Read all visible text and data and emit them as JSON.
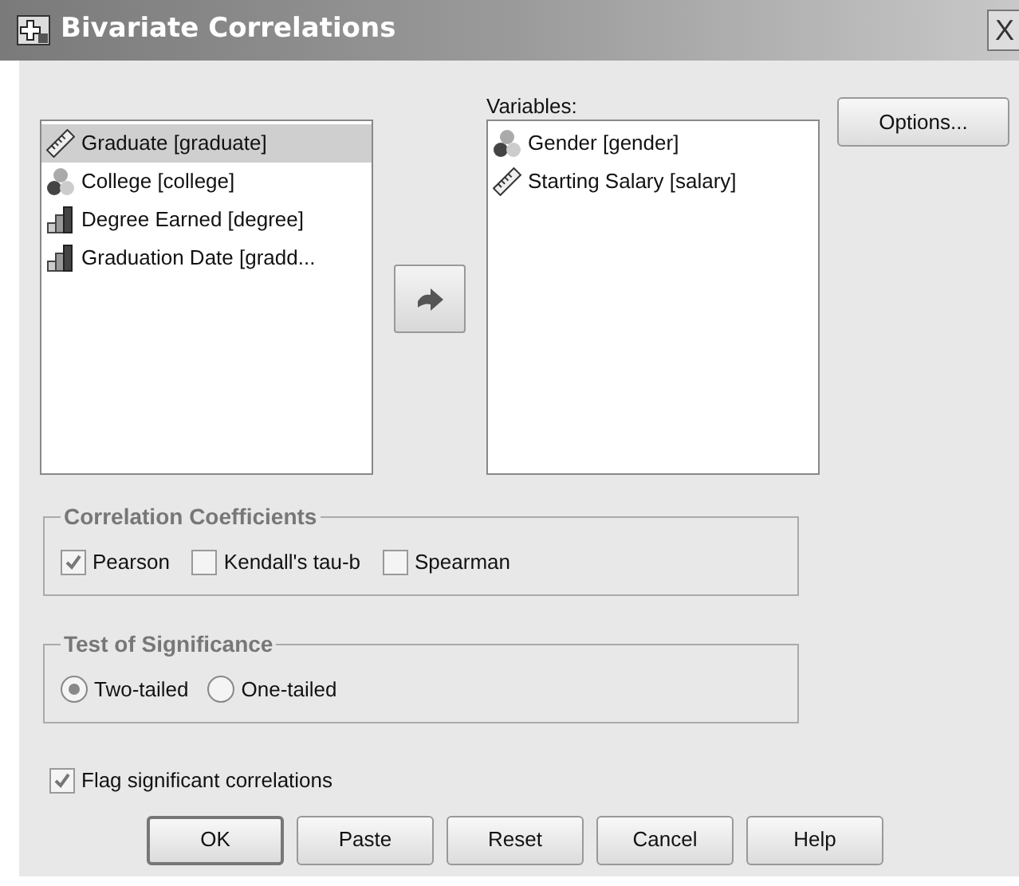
{
  "window": {
    "title": "Bivariate Correlations",
    "close": "X"
  },
  "source_list": {
    "items": [
      {
        "label": "Graduate [graduate]",
        "kind": "scale",
        "selected": true
      },
      {
        "label": "College [college]",
        "kind": "nominal",
        "selected": false
      },
      {
        "label": "Degree Earned [degree]",
        "kind": "ordinal",
        "selected": false
      },
      {
        "label": "Graduation Date [gradd...",
        "kind": "ordinal",
        "selected": false
      }
    ]
  },
  "variables": {
    "label": "Variables:",
    "items": [
      {
        "label": "Gender [gender]",
        "kind": "nominal"
      },
      {
        "label": "Starting Salary [salary]",
        "kind": "scale"
      }
    ]
  },
  "options_button": "Options...",
  "correlation_coefficients": {
    "title": "Correlation Coefficients",
    "options": [
      {
        "label": "Pearson",
        "checked": true
      },
      {
        "label": "Kendall's tau-b",
        "checked": false
      },
      {
        "label": "Spearman",
        "checked": false
      }
    ]
  },
  "test_of_significance": {
    "title": "Test of Significance",
    "options": [
      {
        "label": "Two-tailed",
        "selected": true
      },
      {
        "label": "One-tailed",
        "selected": false
      }
    ]
  },
  "flag_significant": {
    "label": "Flag significant correlations",
    "checked": true
  },
  "buttons": [
    {
      "label": "OK",
      "default": true
    },
    {
      "label": "Paste",
      "default": false
    },
    {
      "label": "Reset",
      "default": false
    },
    {
      "label": "Cancel",
      "default": false
    },
    {
      "label": "Help",
      "default": false
    }
  ]
}
